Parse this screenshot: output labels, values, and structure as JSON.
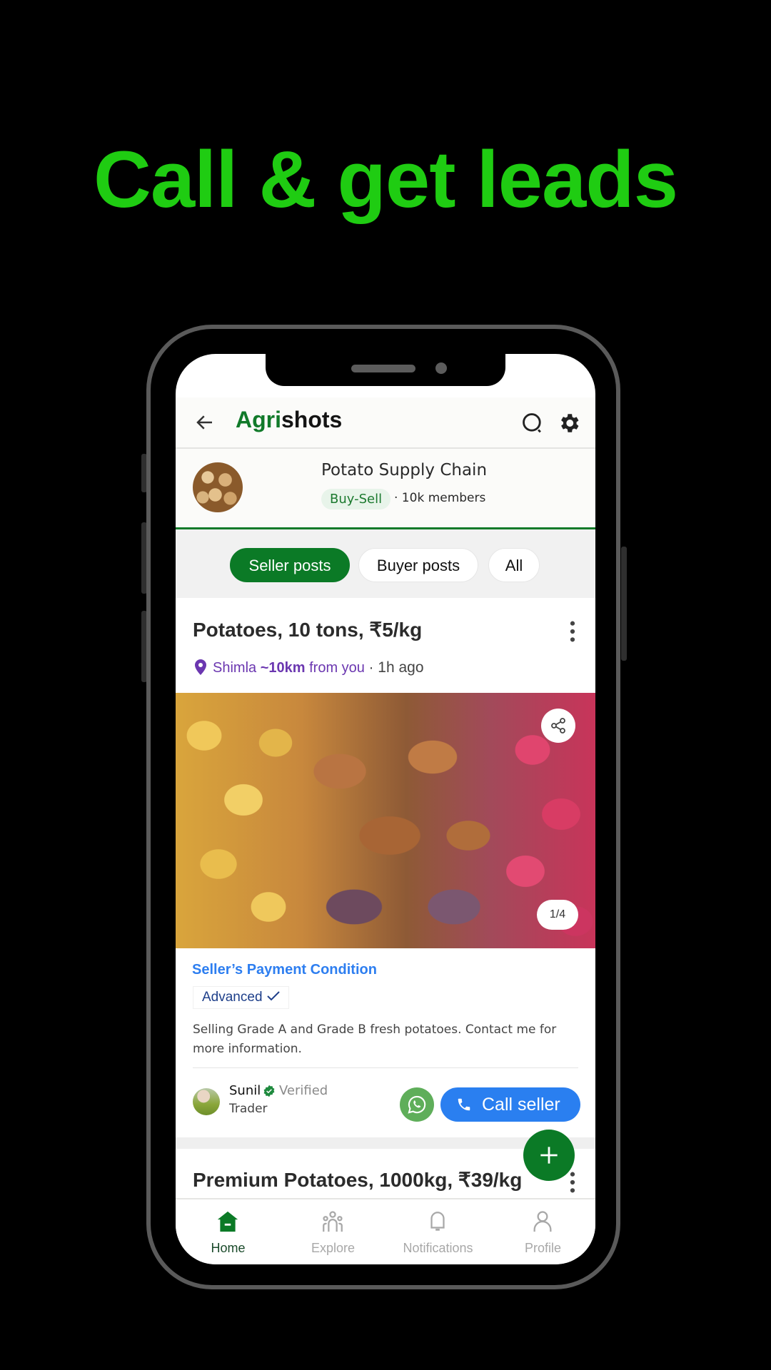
{
  "headline": "Call & get leads",
  "app": {
    "brand_prefix": "Agri",
    "brand_suffix": "shots",
    "colors": {
      "brand_green": "#117a2a",
      "headline_green": "#1fcc12",
      "call_blue": "#2a7ff0",
      "whatsapp_green": "#5fae5a",
      "location_purple": "#6b37b0"
    }
  },
  "header": {
    "back_icon": "arrow-left",
    "search_icon": "search",
    "settings_icon": "gear"
  },
  "group": {
    "name": "Potato Supply Chain",
    "badge": "Buy-Sell",
    "members": "· 10k members"
  },
  "tabs": [
    {
      "label": "Seller posts",
      "active": true
    },
    {
      "label": "Buyer posts",
      "active": false
    },
    {
      "label": "All",
      "active": false
    }
  ],
  "posts": [
    {
      "title": "Potatoes, 10 tons, ₹5/kg",
      "location": "Shimla",
      "distance": "~10km",
      "distance_suffix": "from you",
      "time": "· 1h ago",
      "image_counter": "1/4",
      "payment_title": "Seller’s Payment Condition",
      "payment_value": "Advanced",
      "description": "Selling Grade A and Grade B fresh potatoes. Contact me for more information.",
      "seller": {
        "name": "Sunil",
        "verified_label": "Verified",
        "role": "Trader"
      },
      "call_label": "Call seller"
    },
    {
      "title": "Premium Potatoes, 1000kg, ₹39/kg"
    }
  ],
  "bottom_nav": [
    {
      "label": "Home",
      "icon": "home",
      "active": true
    },
    {
      "label": "Explore",
      "icon": "people",
      "active": false
    },
    {
      "label": "Notifications",
      "icon": "bell",
      "active": false
    },
    {
      "label": "Profile",
      "icon": "person",
      "active": false
    }
  ]
}
